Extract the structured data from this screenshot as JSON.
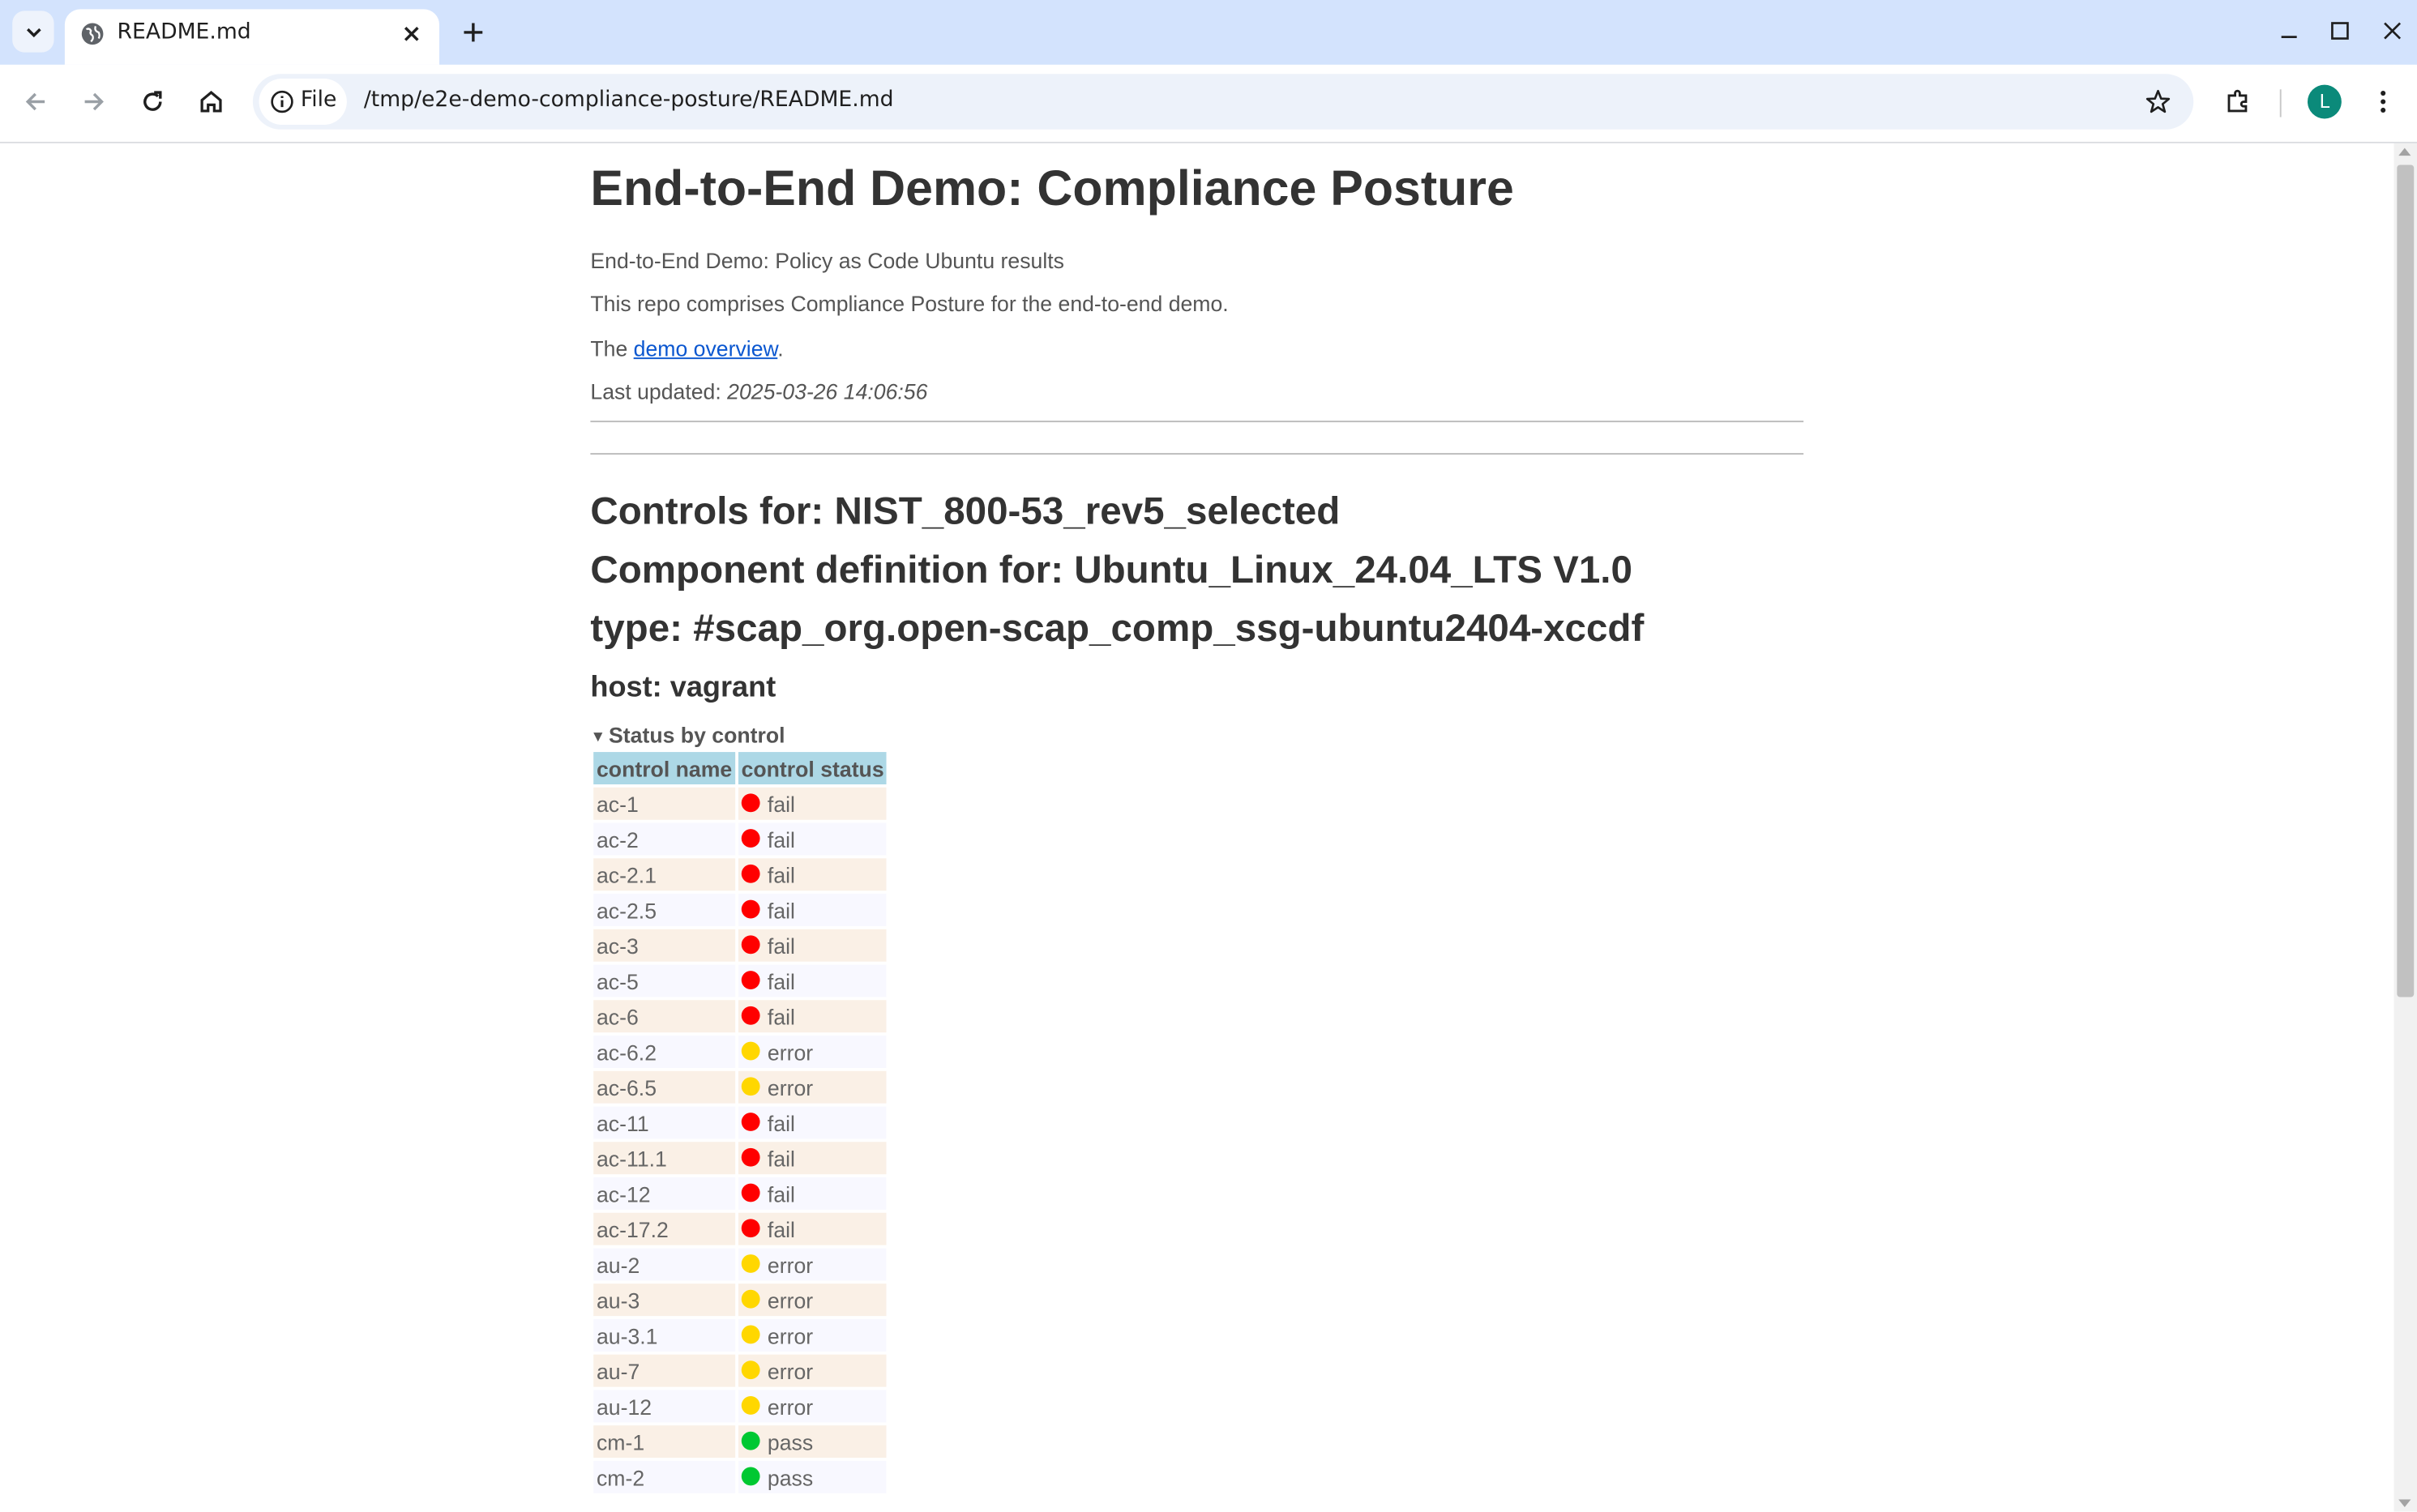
{
  "browser": {
    "tab": {
      "title": "README.md"
    },
    "address": {
      "scheme_label": "File",
      "url": "/tmp/e2e-demo-compliance-posture/README.md"
    },
    "profile_initial": "L"
  },
  "document": {
    "title": "End-to-End Demo: Compliance Posture",
    "subtitle": "End-to-End Demo: Policy as Code Ubuntu results",
    "description": "This repo comprises Compliance Posture for the end-to-end demo.",
    "overview": {
      "prefix": "The ",
      "link_text": "demo overview",
      "suffix": "."
    },
    "last_updated": {
      "label": "Last updated: ",
      "value": "2025-03-26 14:06:56"
    },
    "controls_heading": "Controls for: NIST_800-53_rev5_selected",
    "component_heading": "Component definition for: Ubuntu_Linux_24.04_LTS V1.0",
    "type_heading": "type: #scap_org.open-scap_comp_ssg-ubuntu2404-xccdf",
    "host_heading": "host: vagrant",
    "details_summary": "Status by control",
    "table": {
      "headers": [
        "control name",
        "control status"
      ],
      "rows": [
        {
          "name": "ac-1",
          "status": "fail"
        },
        {
          "name": "ac-2",
          "status": "fail"
        },
        {
          "name": "ac-2.1",
          "status": "fail"
        },
        {
          "name": "ac-2.5",
          "status": "fail"
        },
        {
          "name": "ac-3",
          "status": "fail"
        },
        {
          "name": "ac-5",
          "status": "fail"
        },
        {
          "name": "ac-6",
          "status": "fail"
        },
        {
          "name": "ac-6.2",
          "status": "error"
        },
        {
          "name": "ac-6.5",
          "status": "error"
        },
        {
          "name": "ac-11",
          "status": "fail"
        },
        {
          "name": "ac-11.1",
          "status": "fail"
        },
        {
          "name": "ac-12",
          "status": "fail"
        },
        {
          "name": "ac-17.2",
          "status": "fail"
        },
        {
          "name": "au-2",
          "status": "error"
        },
        {
          "name": "au-3",
          "status": "error"
        },
        {
          "name": "au-3.1",
          "status": "error"
        },
        {
          "name": "au-7",
          "status": "error"
        },
        {
          "name": "au-12",
          "status": "error"
        },
        {
          "name": "cm-1",
          "status": "pass"
        },
        {
          "name": "cm-2",
          "status": "pass"
        }
      ]
    },
    "status_colors": {
      "fail": "#ff0000",
      "error": "#ffd700",
      "pass": "#00c832"
    }
  }
}
